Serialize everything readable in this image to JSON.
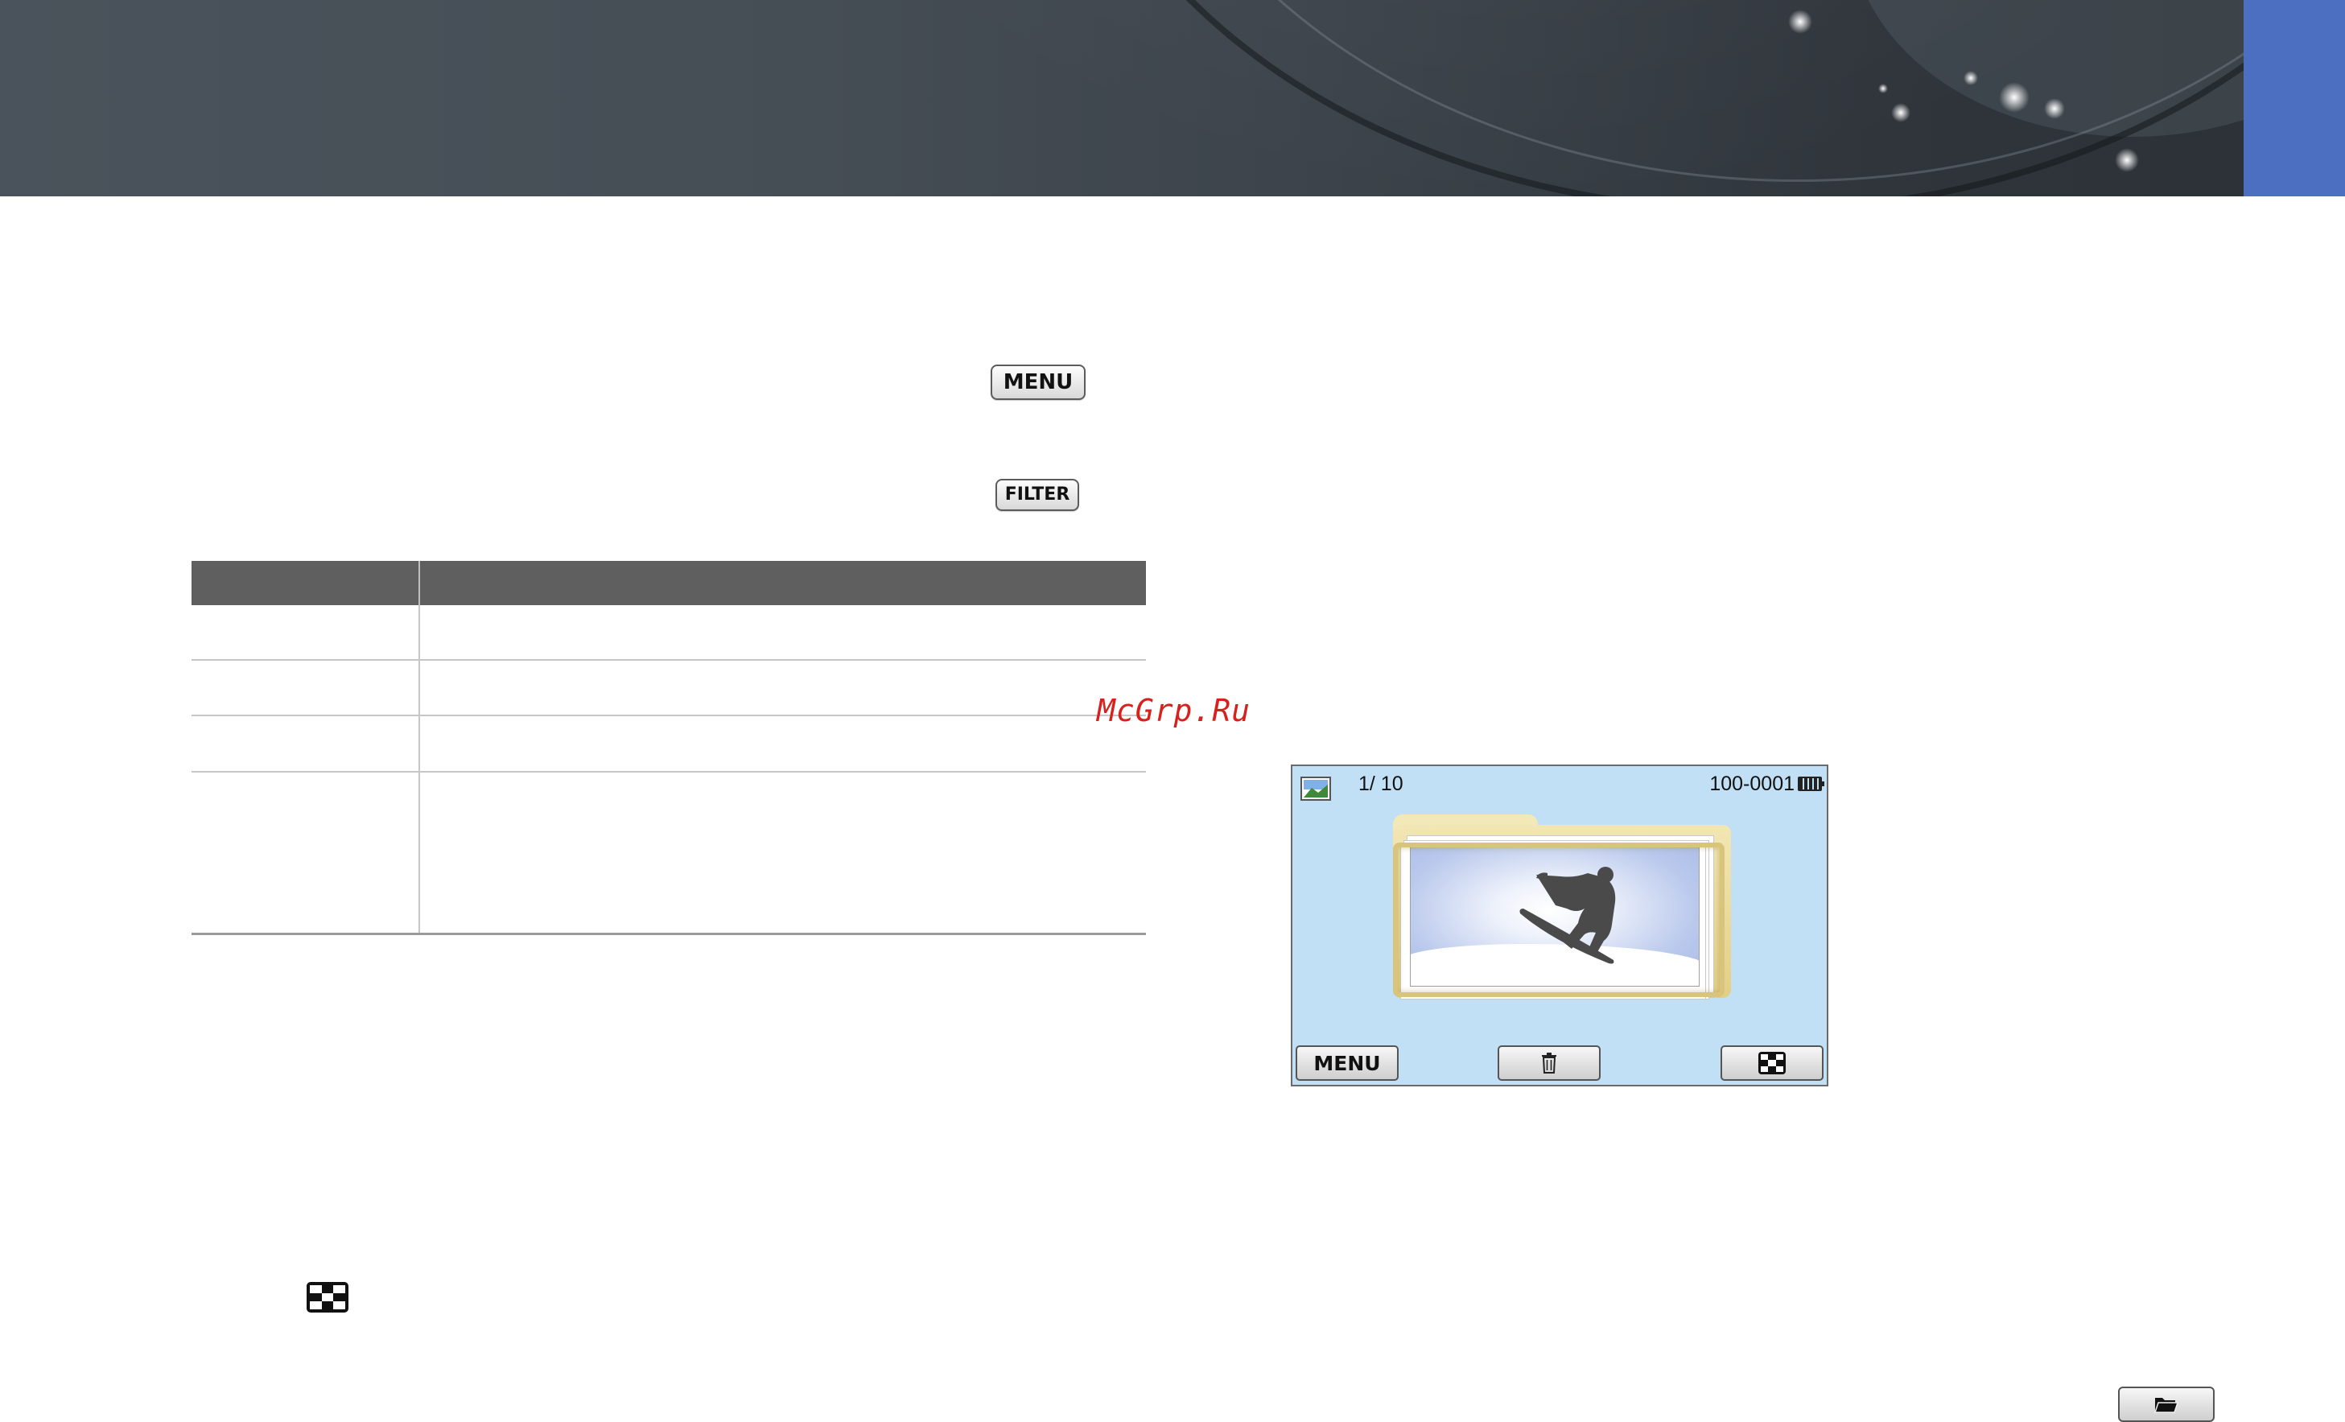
{
  "buttons": {
    "menu_label": "MENU",
    "filter_label": "FILTER"
  },
  "watermark": "McGrp.Ru",
  "camera_screen": {
    "counter": "1/ 10",
    "file_number": "100-0001",
    "menu_label": "MENU",
    "delete_icon": "trash-icon",
    "grid_icon": "grid-view-icon"
  },
  "icons": {
    "inline_grid": "grid-view-icon",
    "folder": "folder-icon"
  },
  "colors": {
    "banner": "#454d55",
    "tab": "#4c6fc2",
    "screen_bg": "#c1dff5",
    "table_header": "#5f5f5f"
  }
}
